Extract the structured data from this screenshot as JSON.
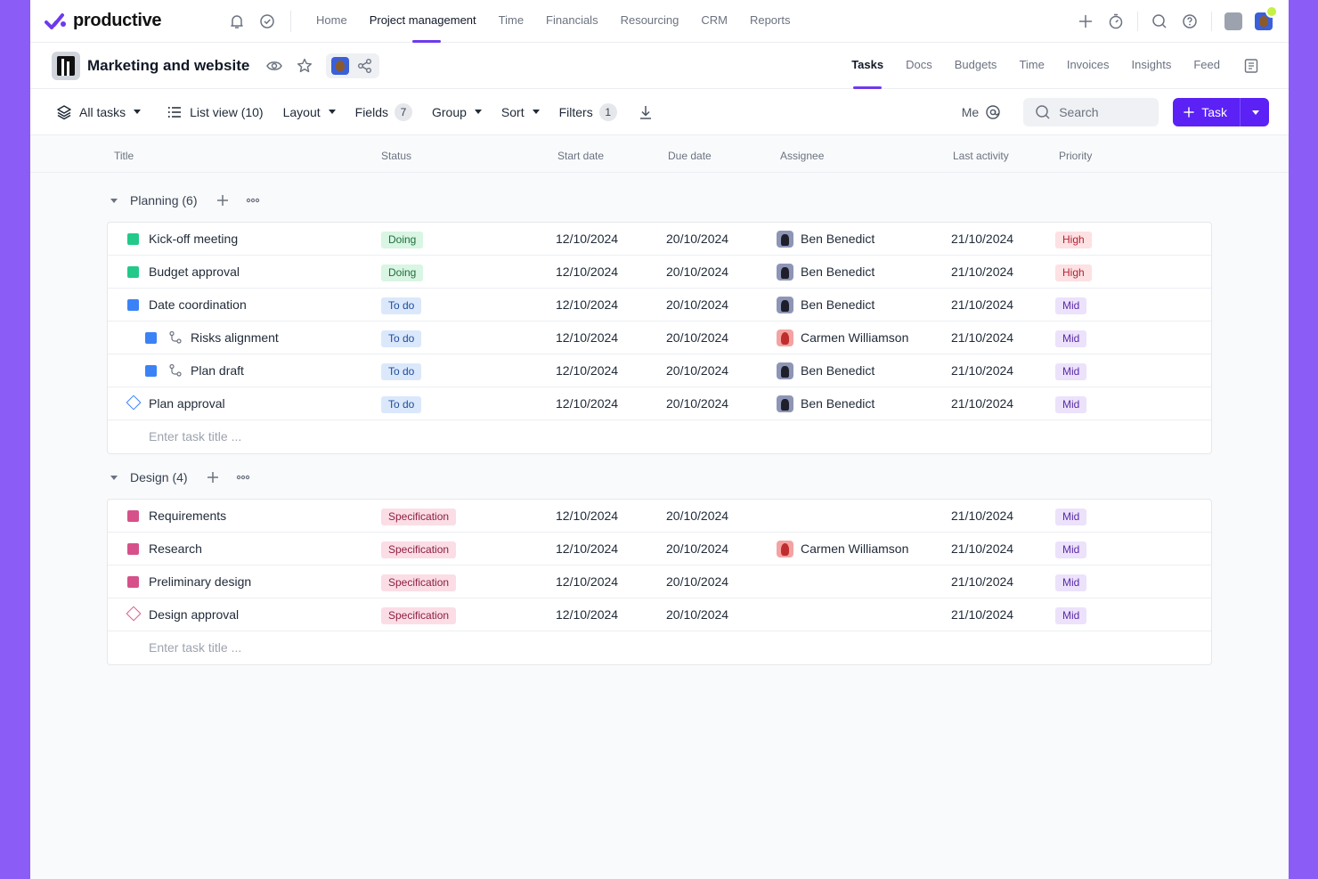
{
  "app": {
    "logo_text": "productive"
  },
  "topnav": {
    "items": [
      {
        "label": "Home"
      },
      {
        "label": "Project management",
        "active": true
      },
      {
        "label": "Time"
      },
      {
        "label": "Financials"
      },
      {
        "label": "Resourcing"
      },
      {
        "label": "CRM"
      },
      {
        "label": "Reports"
      }
    ]
  },
  "project": {
    "title": "Marketing and website",
    "tabs": [
      {
        "label": "Tasks",
        "active": true
      },
      {
        "label": "Docs"
      },
      {
        "label": "Budgets"
      },
      {
        "label": "Time"
      },
      {
        "label": "Invoices"
      },
      {
        "label": "Insights"
      },
      {
        "label": "Feed"
      }
    ]
  },
  "toolbar": {
    "all_tasks": "All tasks",
    "list_view": "List view (10)",
    "layout": "Layout",
    "fields": "Fields",
    "fields_count": "7",
    "group": "Group",
    "sort": "Sort",
    "filters": "Filters",
    "filters_count": "1",
    "me": "Me",
    "search_placeholder": "Search",
    "task_button": "Task"
  },
  "columns": {
    "title": "Title",
    "status": "Status",
    "start_date": "Start date",
    "due_date": "Due date",
    "assignee": "Assignee",
    "last_activity": "Last activity",
    "priority": "Priority"
  },
  "groups": [
    {
      "name": "Planning (6)",
      "color": "#2ecc8a",
      "enter_placeholder": "Enter task title ...",
      "tasks": [
        {
          "title": "Kick-off meeting",
          "icon": "square",
          "color": "#22c98a",
          "status": "Doing",
          "status_kind": "doing",
          "start": "12/10/2024",
          "due": "20/10/2024",
          "assignee": "Ben Benedict",
          "avatar": "ben",
          "last": "21/10/2024",
          "priority": "High",
          "priority_kind": "high"
        },
        {
          "title": "Budget approval",
          "icon": "square",
          "color": "#22c98a",
          "status": "Doing",
          "status_kind": "doing",
          "start": "12/10/2024",
          "due": "20/10/2024",
          "assignee": "Ben Benedict",
          "avatar": "ben",
          "last": "21/10/2024",
          "priority": "High",
          "priority_kind": "high"
        },
        {
          "title": "Date coordination",
          "icon": "square",
          "color": "#3b82f6",
          "status": "To do",
          "status_kind": "todo",
          "start": "12/10/2024",
          "due": "20/10/2024",
          "assignee": "Ben Benedict",
          "avatar": "ben",
          "last": "21/10/2024",
          "priority": "Mid",
          "priority_kind": "mid"
        },
        {
          "title": "Risks alignment",
          "icon": "subtask",
          "color": "#3b82f6",
          "status": "To do",
          "status_kind": "todo",
          "start": "12/10/2024",
          "due": "20/10/2024",
          "assignee": "Carmen Williamson",
          "avatar": "carmen",
          "last": "21/10/2024",
          "priority": "Mid",
          "priority_kind": "mid"
        },
        {
          "title": "Plan draft",
          "icon": "subtask",
          "color": "#3b82f6",
          "status": "To do",
          "status_kind": "todo",
          "start": "12/10/2024",
          "due": "20/10/2024",
          "assignee": "Ben Benedict",
          "avatar": "ben",
          "last": "21/10/2024",
          "priority": "Mid",
          "priority_kind": "mid"
        },
        {
          "title": "Plan approval",
          "icon": "diamond",
          "color": "#3b82f6",
          "status": "To do",
          "status_kind": "todo",
          "start": "12/10/2024",
          "due": "20/10/2024",
          "assignee": "Ben Benedict",
          "avatar": "ben",
          "last": "21/10/2024",
          "priority": "Mid",
          "priority_kind": "mid"
        }
      ]
    },
    {
      "name": "Design (4)",
      "color": "#d6518a",
      "enter_placeholder": "Enter task title ...",
      "tasks": [
        {
          "title": "Requirements",
          "icon": "square",
          "color": "#d6518a",
          "status": "Specification",
          "status_kind": "spec",
          "start": "12/10/2024",
          "due": "20/10/2024",
          "assignee": "",
          "avatar": "",
          "last": "21/10/2024",
          "priority": "Mid",
          "priority_kind": "mid"
        },
        {
          "title": "Research",
          "icon": "square",
          "color": "#d6518a",
          "status": "Specification",
          "status_kind": "spec",
          "start": "12/10/2024",
          "due": "20/10/2024",
          "assignee": "Carmen Williamson",
          "avatar": "carmen",
          "last": "21/10/2024",
          "priority": "Mid",
          "priority_kind": "mid"
        },
        {
          "title": "Preliminary design",
          "icon": "square",
          "color": "#d6518a",
          "status": "Specification",
          "status_kind": "spec",
          "start": "12/10/2024",
          "due": "20/10/2024",
          "assignee": "",
          "avatar": "",
          "last": "21/10/2024",
          "priority": "Mid",
          "priority_kind": "mid"
        },
        {
          "title": "Design approval",
          "icon": "diamond",
          "color": "#e0578f",
          "status": "Specification",
          "status_kind": "spec",
          "start": "12/10/2024",
          "due": "20/10/2024",
          "assignee": "",
          "avatar": "",
          "last": "21/10/2024",
          "priority": "Mid",
          "priority_kind": "mid"
        }
      ]
    }
  ],
  "colors": {
    "accent": "#5b21f5",
    "frame": "#8b5cf6"
  }
}
